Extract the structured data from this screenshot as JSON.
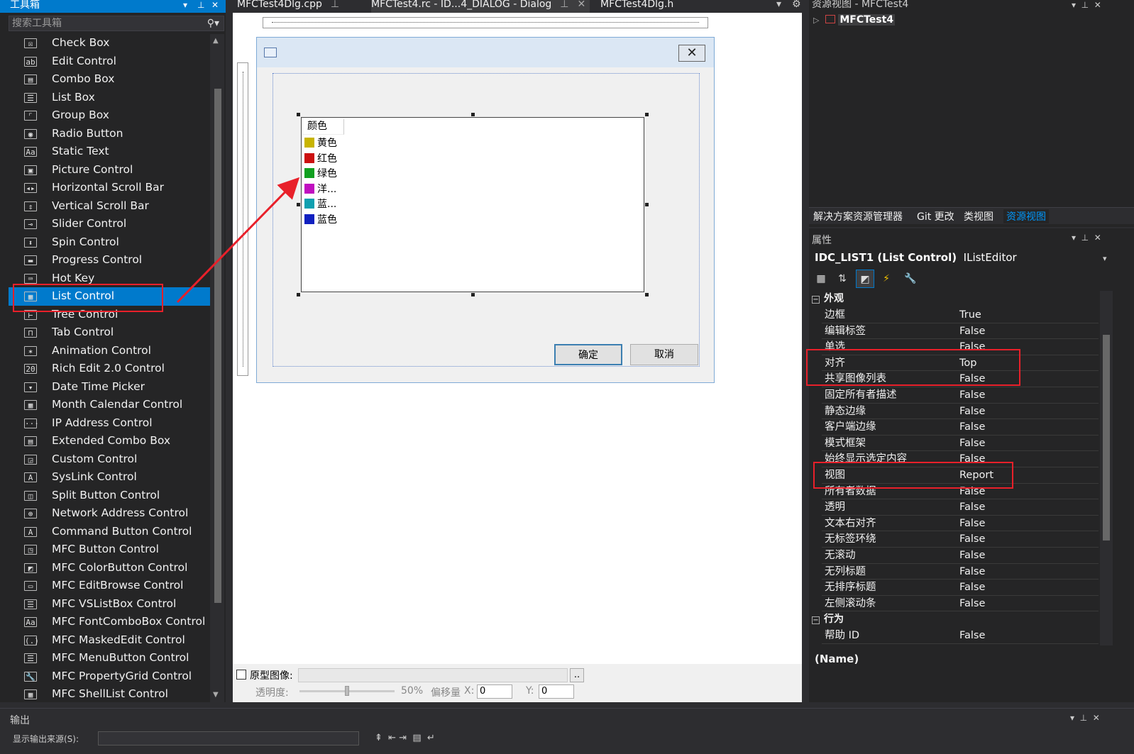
{
  "toolbox": {
    "title": "工具箱",
    "search_placeholder": "搜索工具箱",
    "items": [
      {
        "label": "Check Box",
        "icon": "checkbox-icon",
        "glyph": "☒"
      },
      {
        "label": "Edit Control",
        "icon": "edit-control-icon",
        "glyph": "ab"
      },
      {
        "label": "Combo Box",
        "icon": "combo-box-icon",
        "glyph": "▤"
      },
      {
        "label": "List Box",
        "icon": "list-box-icon",
        "glyph": "☰"
      },
      {
        "label": "Group Box",
        "icon": "group-box-icon",
        "glyph": "⌜"
      },
      {
        "label": "Radio Button",
        "icon": "radio-button-icon",
        "glyph": "◉"
      },
      {
        "label": "Static Text",
        "icon": "static-text-icon",
        "glyph": "Aa"
      },
      {
        "label": "Picture Control",
        "icon": "picture-control-icon",
        "glyph": "▣"
      },
      {
        "label": "Horizontal Scroll Bar",
        "icon": "hscroll-icon",
        "glyph": "◂▸"
      },
      {
        "label": "Vertical Scroll Bar",
        "icon": "vscroll-icon",
        "glyph": "⇕"
      },
      {
        "label": "Slider Control",
        "icon": "slider-icon",
        "glyph": "⊸"
      },
      {
        "label": "Spin Control",
        "icon": "spin-icon",
        "glyph": "⬍"
      },
      {
        "label": "Progress Control",
        "icon": "progress-icon",
        "glyph": "▬"
      },
      {
        "label": "Hot Key",
        "icon": "hot-key-icon",
        "glyph": "⌨"
      },
      {
        "label": "List Control",
        "icon": "list-control-icon",
        "glyph": "▦"
      },
      {
        "label": "Tree Control",
        "icon": "tree-control-icon",
        "glyph": "⊢"
      },
      {
        "label": "Tab Control",
        "icon": "tab-control-icon",
        "glyph": "⊓"
      },
      {
        "label": "Animation Control",
        "icon": "animation-icon",
        "glyph": "✶"
      },
      {
        "label": "Rich Edit 2.0 Control",
        "icon": "rich-edit-icon",
        "glyph": "20"
      },
      {
        "label": "Date Time Picker",
        "icon": "date-time-icon",
        "glyph": "▾"
      },
      {
        "label": "Month Calendar Control",
        "icon": "calendar-icon",
        "glyph": "▦"
      },
      {
        "label": "IP Address Control",
        "icon": "ip-address-icon",
        "glyph": "···"
      },
      {
        "label": "Extended Combo Box",
        "icon": "ext-combo-icon",
        "glyph": "▤"
      },
      {
        "label": "Custom Control",
        "icon": "custom-control-icon",
        "glyph": "◲"
      },
      {
        "label": "SysLink Control",
        "icon": "syslink-icon",
        "glyph": "A"
      },
      {
        "label": "Split Button Control",
        "icon": "split-button-icon",
        "glyph": "◫"
      },
      {
        "label": "Network Address Control",
        "icon": "network-address-icon",
        "glyph": "⊕"
      },
      {
        "label": "Command Button Control",
        "icon": "command-button-icon",
        "glyph": "A"
      },
      {
        "label": "MFC Button Control",
        "icon": "mfc-button-icon",
        "glyph": "◳"
      },
      {
        "label": "MFC ColorButton Control",
        "icon": "mfc-colorbutton-icon",
        "glyph": "◩"
      },
      {
        "label": "MFC EditBrowse Control",
        "icon": "mfc-editbrowse-icon",
        "glyph": "▭"
      },
      {
        "label": "MFC VSListBox Control",
        "icon": "mfc-vslistbox-icon",
        "glyph": "☰"
      },
      {
        "label": "MFC FontComboBox Control",
        "icon": "mfc-fontcombo-icon",
        "glyph": "Aa"
      },
      {
        "label": "MFC MaskedEdit Control",
        "icon": "mfc-maskededit-icon",
        "glyph": "(.)"
      },
      {
        "label": "MFC MenuButton Control",
        "icon": "mfc-menubutton-icon",
        "glyph": "☰"
      },
      {
        "label": "MFC PropertyGrid Control",
        "icon": "mfc-propertygrid-icon",
        "glyph": "🔧"
      },
      {
        "label": "MFC ShellList Control",
        "icon": "mfc-shelllist-icon",
        "glyph": "▦"
      }
    ],
    "selected_index": 14
  },
  "tabs": [
    {
      "label": "MFCTest4Dlg.cpp",
      "suffix": "⊕"
    },
    {
      "label": "MFCTest4.rc - ID...4_DIALOG - Dialog",
      "suffix": "⊕ ×"
    },
    {
      "label": "MFCTest4Dlg.h",
      "suffix": ""
    }
  ],
  "dialog": {
    "list_header": "颜色",
    "list_rows": [
      {
        "text": "黄色",
        "color": "#c8b400"
      },
      {
        "text": "红色",
        "color": "#cc1010"
      },
      {
        "text": "绿色",
        "color": "#10a020"
      },
      {
        "text": "洋...",
        "color": "#c010c0"
      },
      {
        "text": "蓝...",
        "color": "#10a0b0"
      },
      {
        "text": "蓝色",
        "color": "#1020c0"
      }
    ],
    "ok_label": "确定",
    "cancel_label": "取消"
  },
  "designer_options": {
    "prototype_label": "原型图像:",
    "browse_label": "..",
    "opacity_label": "透明度:",
    "opacity_value": "50%",
    "offset_label": "偏移量",
    "x_label": "X:",
    "x_value": "0",
    "y_label": "Y:",
    "y_value": "0"
  },
  "resource_view": {
    "title": "资源视图 - MFCTest4",
    "root": "MFCTest4",
    "tabs": [
      "解决方案资源管理器",
      "Git 更改",
      "类视图",
      "资源视图"
    ],
    "active_tab": 3
  },
  "properties": {
    "title": "属性",
    "object_id": "IDC_LIST1 (List Control)",
    "object_editor": "IListEditor",
    "categories": [
      {
        "name": "外观",
        "rows": [
          {
            "k": "边框",
            "v": "True"
          },
          {
            "k": "编辑标签",
            "v": "False"
          },
          {
            "k": "单选",
            "v": "False"
          },
          {
            "k": "对齐",
            "v": "Top"
          },
          {
            "k": "共享图像列表",
            "v": "False"
          },
          {
            "k": "固定所有者描述",
            "v": "False"
          },
          {
            "k": "静态边缘",
            "v": "False"
          },
          {
            "k": "客户端边缘",
            "v": "False"
          },
          {
            "k": "模式框架",
            "v": "False"
          },
          {
            "k": "始终显示选定内容",
            "v": "False"
          },
          {
            "k": "视图",
            "v": "Report"
          },
          {
            "k": "所有者数据",
            "v": "False"
          },
          {
            "k": "透明",
            "v": "False"
          },
          {
            "k": "文本右对齐",
            "v": "False"
          },
          {
            "k": "无标签环绕",
            "v": "False"
          },
          {
            "k": "无滚动",
            "v": "False"
          },
          {
            "k": "无列标题",
            "v": "False"
          },
          {
            "k": "无排序标题",
            "v": "False"
          },
          {
            "k": "左侧滚动条",
            "v": "False"
          }
        ]
      },
      {
        "name": "行为",
        "rows": [
          {
            "k": "帮助 ID",
            "v": "False"
          }
        ]
      }
    ],
    "description_name": "(Name)"
  },
  "output": {
    "title": "输出",
    "source_label": "显示输出来源(S):"
  },
  "colors": {
    "accent": "#007acc",
    "annotation_red": "#e8202a",
    "panel_bg": "#252526"
  }
}
